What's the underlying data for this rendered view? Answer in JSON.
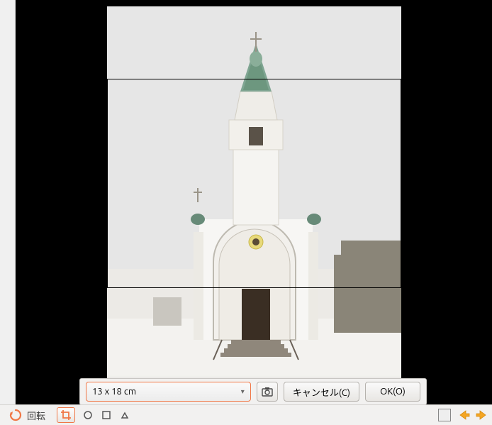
{
  "crop": {
    "size_label": "13 x 18 cm",
    "cancel_label": "キャンセル(C)",
    "ok_label": "OK(O)"
  },
  "bottombar": {
    "rotate_label": "回転"
  },
  "icons": {
    "camera_orient": "camera-orient-icon",
    "rotate": "rotate-icon"
  }
}
